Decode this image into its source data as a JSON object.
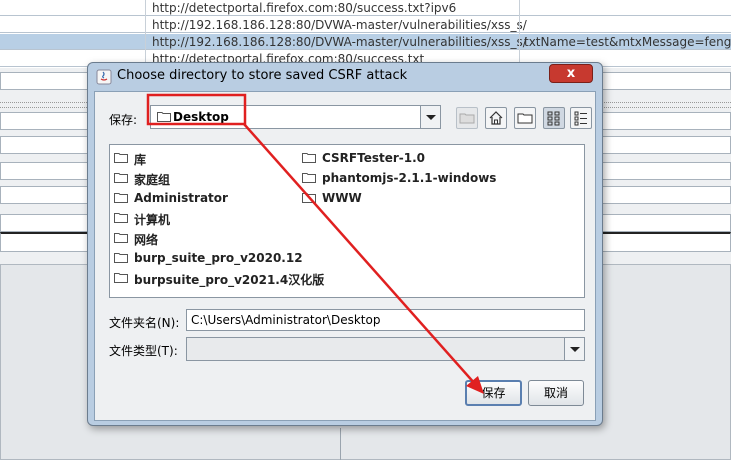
{
  "background": {
    "rows": [
      {
        "url": "http://detectportal.firefox.com:80/success.txt?ipv6",
        "param": "",
        "selected": false
      },
      {
        "url": "http://192.168.186.128:80/DVWA-master/vulnerabilities/xss_s/",
        "param": "",
        "selected": false
      },
      {
        "url": "http://192.168.186.128:80/DVWA-master/vulnerabilities/xss_s/",
        "param": "txtName=test&mtxMessage=fengzilin-",
        "selected": true
      },
      {
        "url": "http://detectportal.firefox.com:80/success.txt",
        "param": "",
        "selected": false
      }
    ]
  },
  "dialog": {
    "title": "Choose directory to store saved CSRF attack",
    "close_label": "x",
    "save_in_label": "保存:",
    "current_dir": "Desktop",
    "toolbar_icons": [
      "up-folder-icon",
      "home-icon",
      "new-folder-icon",
      "list-view-icon",
      "details-view-icon"
    ],
    "files_col1": [
      "库",
      "家庭组",
      "Administrator",
      "计算机",
      "网络",
      "burp_suite_pro_v2020.12",
      "burpsuite_pro_v2021.4汉化版"
    ],
    "files_col2": [
      "CSRFTester-1.0",
      "phantomjs-2.1.1-windows",
      "WWW"
    ],
    "filename_label": "文件夹名(N):",
    "filename_value": "C:\\Users\\Administrator\\Desktop",
    "filetype_label": "文件类型(T):",
    "filetype_value": "",
    "save_button": "保存",
    "cancel_button": "取消"
  },
  "annotation": {
    "color": "#e02020"
  }
}
